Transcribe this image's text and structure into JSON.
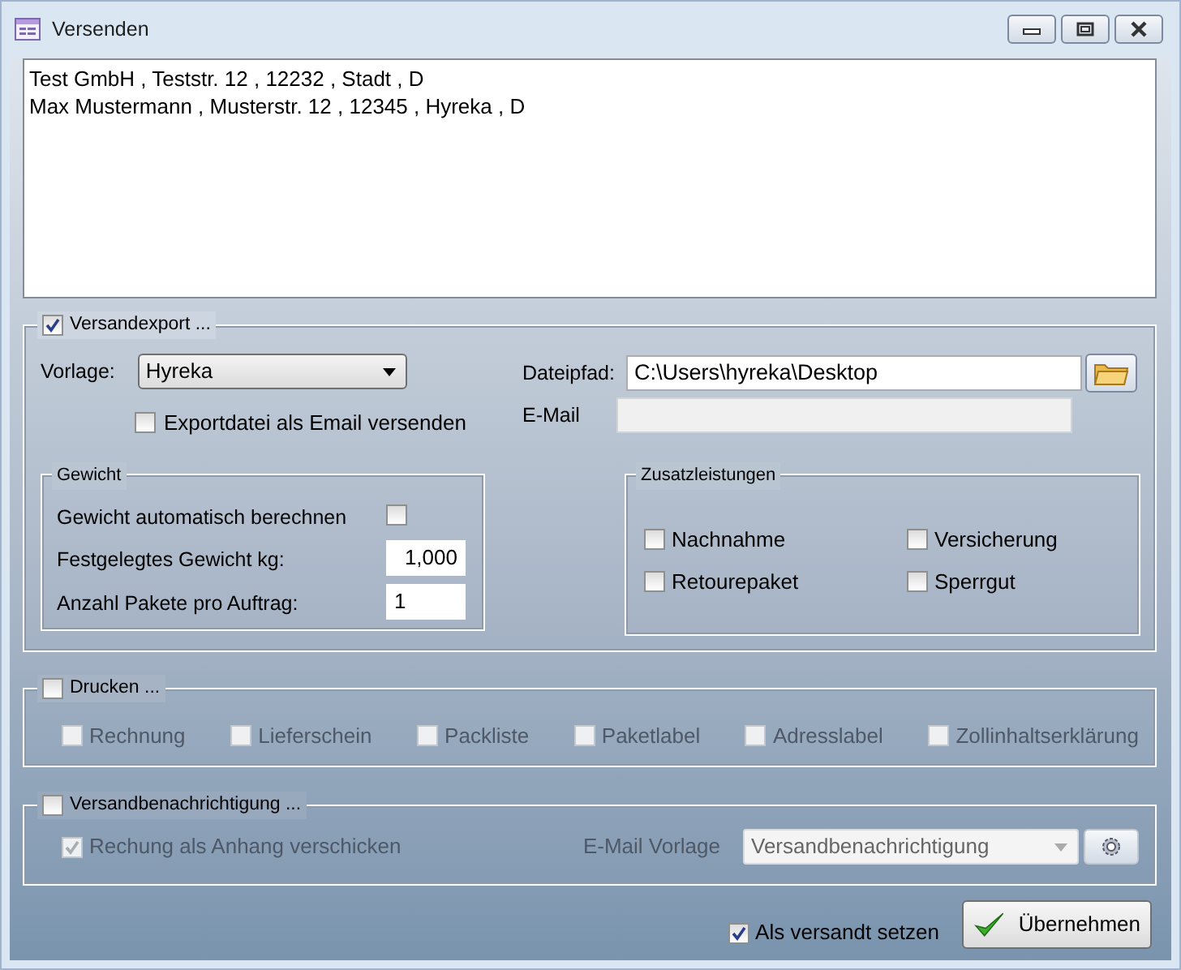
{
  "window": {
    "title": "Versenden"
  },
  "address_list": {
    "lines": [
      "Test GmbH , Teststr. 12 , 12232 , Stadt , D",
      "Max Mustermann , Musterstr. 12 , 12345 , Hyreka , D"
    ]
  },
  "versandexport": {
    "label": "Versandexport ...",
    "checked": true,
    "vorlage": {
      "label": "Vorlage:",
      "value": "Hyreka"
    },
    "dateipfad": {
      "label": "Dateipfad:",
      "value": "C:\\Users\\hyreka\\Desktop"
    },
    "email_option": {
      "label": "Exportdatei als Email versenden",
      "checked": false
    },
    "email": {
      "label": "E-Mail",
      "disabled": true
    },
    "gewicht": {
      "title": "Gewicht",
      "auto": {
        "label": "Gewicht automatisch berechnen",
        "checked": false
      },
      "fixed": {
        "label": "Festgelegtes Gewicht kg:",
        "value": "1,000"
      },
      "pakete": {
        "label": "Anzahl Pakete pro Auftrag:",
        "value": "1"
      }
    },
    "zusatzleistungen": {
      "title": "Zusatzleistungen",
      "options": [
        {
          "label": "Nachnahme",
          "checked": false
        },
        {
          "label": "Versicherung",
          "checked": false
        },
        {
          "label": "Retourepaket",
          "checked": false
        },
        {
          "label": "Sperrgut",
          "checked": false
        }
      ]
    }
  },
  "drucken": {
    "label": "Drucken ...",
    "checked": false,
    "options": [
      {
        "label": "Rechnung",
        "checked": false,
        "disabled": true
      },
      {
        "label": "Lieferschein",
        "checked": false,
        "disabled": true
      },
      {
        "label": "Packliste",
        "checked": false,
        "disabled": true
      },
      {
        "label": "Paketlabel",
        "checked": false,
        "disabled": true
      },
      {
        "label": "Adresslabel",
        "checked": false,
        "disabled": true
      },
      {
        "label": "Zollinhaltserklärung",
        "checked": false,
        "disabled": true
      }
    ]
  },
  "benachrichtigung": {
    "label": "Versandbenachrichtigung ...",
    "checked": false,
    "anhang": {
      "label": "Rechung als Anhang verschicken",
      "checked": true,
      "disabled": true
    },
    "vorlage": {
      "label": "E-Mail Vorlage",
      "value": "Versandbenachrichtigung",
      "disabled": true
    }
  },
  "footer": {
    "versandt": {
      "label": "Als versandt setzen",
      "checked": true
    },
    "submit": {
      "label": "Übernehmen"
    }
  }
}
